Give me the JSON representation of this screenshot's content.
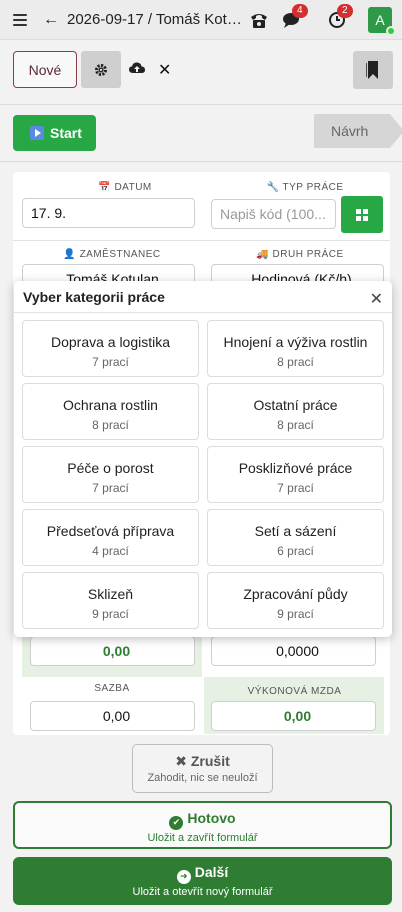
{
  "topbar": {
    "breadcrumb": "2026-09-17 / Tomáš Kotul...",
    "chat_badge": "4",
    "clock_badge": "2",
    "avatar_letter": "A"
  },
  "toolbar": {
    "new_label": "Nové",
    "start_label": "Start",
    "draft_label": "Návrh"
  },
  "form": {
    "date_label": "DATUM",
    "date_value": "17. 9.",
    "worktype_label": "TYP PRÁCE",
    "worktype_placeholder": "Napiš kód (100...",
    "employee_label": "ZAMĚSTNANEC",
    "employee_value": "Tomáš Kotulan",
    "kind_label": "DRUH PRÁCE",
    "kind_value": "Hodinová (Kč/h)",
    "amount_value": "0,00",
    "amount2_value": "0,0000",
    "rate_label": "SAZBA",
    "rate_value": "0,00",
    "wage_label": "VÝKONOVÁ MZDA",
    "wage_value": "0,00"
  },
  "modal": {
    "title": "Vyber kategorii práce",
    "categories": [
      {
        "name": "Doprava a logistika",
        "count": "7 prací"
      },
      {
        "name": "Hnojení a výživa rostlin",
        "count": "8 prací"
      },
      {
        "name": "Ochrana rostlin",
        "count": "8 prací"
      },
      {
        "name": "Ostatní práce",
        "count": "8 prací"
      },
      {
        "name": "Péče o porost",
        "count": "7 prací"
      },
      {
        "name": "Posklizňové práce",
        "count": "7 prací"
      },
      {
        "name": "Předseťová příprava",
        "count": "4 prací"
      },
      {
        "name": "Setí a sázení",
        "count": "6 prací"
      },
      {
        "name": "Sklizeň",
        "count": "9 prací"
      },
      {
        "name": "Zpracování půdy",
        "count": "9 prací"
      }
    ]
  },
  "actions": {
    "cancel_label": "Zrušit",
    "cancel_sub": "Zahodit, nic se neuloží",
    "done_label": "Hotovo",
    "done_sub": "Uložit a zavřít formulář",
    "next_label": "Další",
    "next_sub": "Uložit a otevřít nový formulář"
  },
  "colors": {
    "primary_green": "#28a745",
    "dark_green": "#2e7d32",
    "badge_red": "#d32f2f"
  }
}
